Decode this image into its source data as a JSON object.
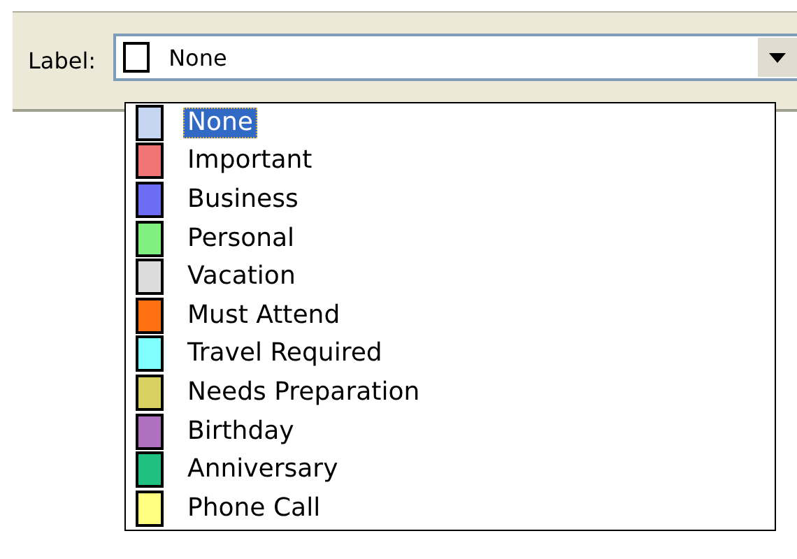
{
  "label_field": {
    "label": "Label:",
    "value": "None",
    "expanded": true
  },
  "options": [
    {
      "text": "None",
      "color": "#c6d6f2",
      "selected": true
    },
    {
      "text": "Important",
      "color": "#f07474",
      "selected": false
    },
    {
      "text": "Business",
      "color": "#6c6cf4",
      "selected": false
    },
    {
      "text": "Personal",
      "color": "#80f080",
      "selected": false
    },
    {
      "text": "Vacation",
      "color": "#dcdcdc",
      "selected": false
    },
    {
      "text": "Must Attend",
      "color": "#ff7010",
      "selected": false
    },
    {
      "text": "Travel Required",
      "color": "#80ffff",
      "selected": false
    },
    {
      "text": "Needs Preparation",
      "color": "#d8d060",
      "selected": false
    },
    {
      "text": "Birthday",
      "color": "#b070c0",
      "selected": false
    },
    {
      "text": "Anniversary",
      "color": "#20c080",
      "selected": false
    },
    {
      "text": "Phone Call",
      "color": "#ffff80",
      "selected": false
    }
  ]
}
